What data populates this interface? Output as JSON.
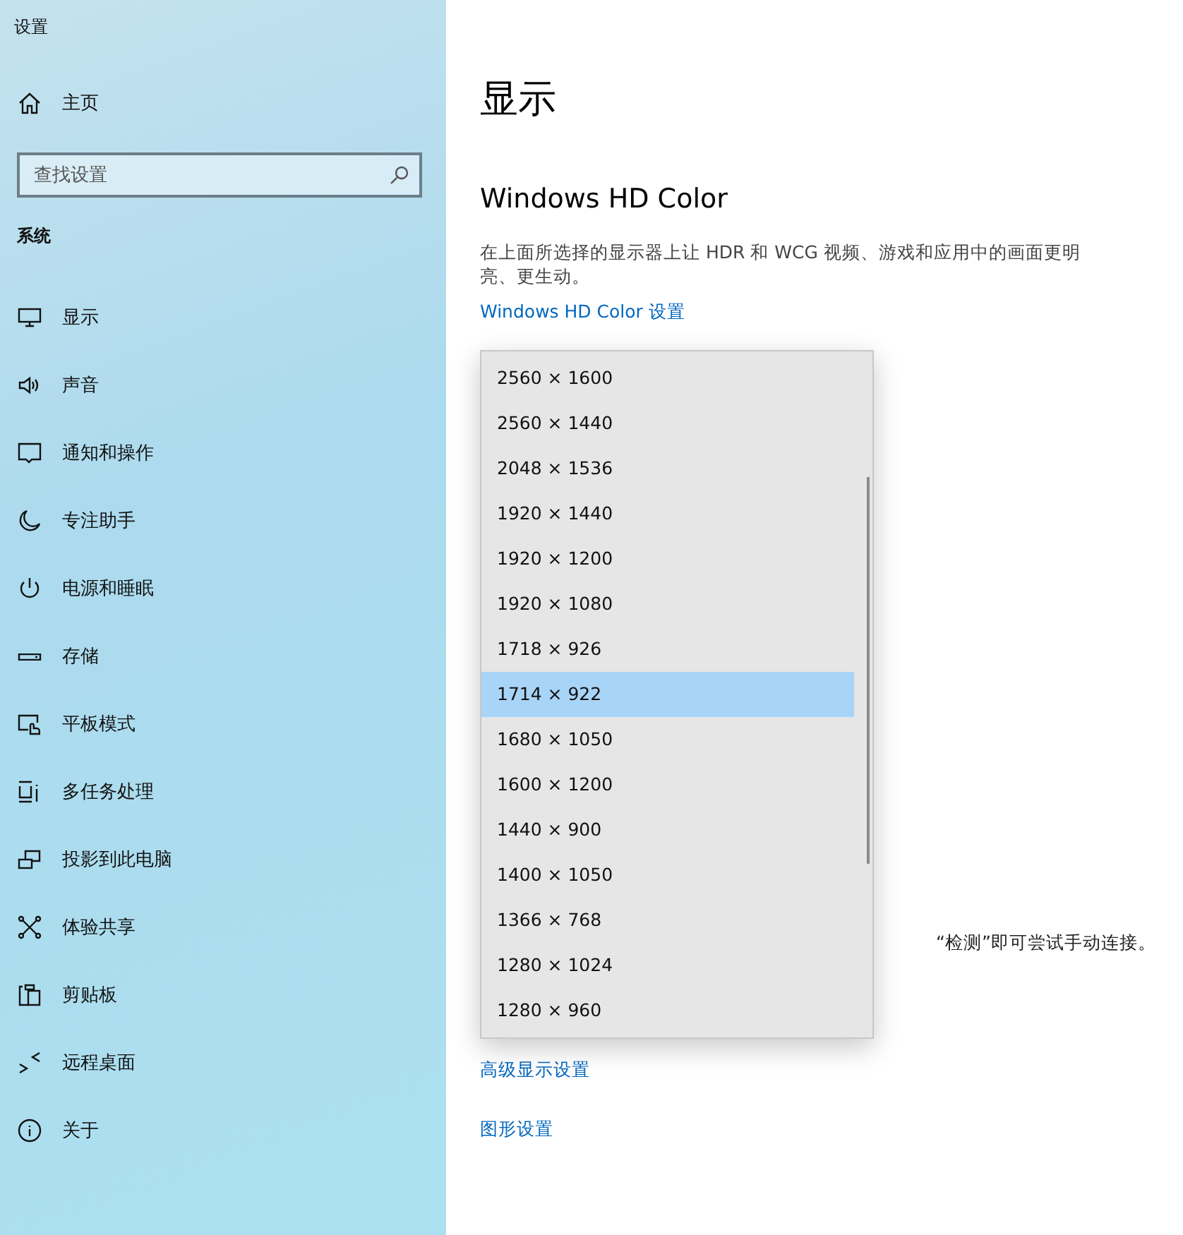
{
  "window": {
    "title": "设置"
  },
  "sidebar": {
    "home": {
      "label": "主页"
    },
    "search": {
      "placeholder": "查找设置"
    },
    "section": "系统",
    "items": [
      {
        "label": "显示",
        "selected": false
      },
      {
        "label": "声音",
        "selected": false
      },
      {
        "label": "通知和操作",
        "selected": false
      },
      {
        "label": "专注助手",
        "selected": false
      },
      {
        "label": "电源和睡眠",
        "selected": false
      },
      {
        "label": "存储",
        "selected": false
      },
      {
        "label": "平板模式",
        "selected": false
      },
      {
        "label": "多任务处理",
        "selected": false
      },
      {
        "label": "投影到此电脑",
        "selected": false
      },
      {
        "label": "体验共享",
        "selected": false
      },
      {
        "label": "剪贴板",
        "selected": false
      },
      {
        "label": "远程桌面",
        "selected": false
      },
      {
        "label": "关于",
        "selected": false
      }
    ]
  },
  "main": {
    "heading": "显示",
    "section_title": "Windows HD Color",
    "description": "在上面所选择的显示器上让 HDR 和 WCG 视频、游戏和应用中的画面更明亮、更生动。",
    "hd_link": "Windows HD Color 设置",
    "partial_text": "“检测”即可尝试手动连接。",
    "links": [
      "高级显示设置",
      "图形设置"
    ]
  },
  "dropdown": {
    "options": [
      {
        "label": "2560 × 1600",
        "selected": false
      },
      {
        "label": "2560 × 1440",
        "selected": false
      },
      {
        "label": "2048 × 1536",
        "selected": false
      },
      {
        "label": "1920 × 1440",
        "selected": false
      },
      {
        "label": "1920 × 1200",
        "selected": false
      },
      {
        "label": "1920 × 1080",
        "selected": false
      },
      {
        "label": "1718 × 926",
        "selected": false
      },
      {
        "label": "1714 × 922",
        "selected": true
      },
      {
        "label": "1680 × 1050",
        "selected": false
      },
      {
        "label": "1600 × 1200",
        "selected": false
      },
      {
        "label": "1440 × 900",
        "selected": false
      },
      {
        "label": "1400 × 1050",
        "selected": false
      },
      {
        "label": "1366 × 768",
        "selected": false
      },
      {
        "label": "1280 × 1024",
        "selected": false
      },
      {
        "label": "1280 × 960",
        "selected": false
      }
    ]
  }
}
